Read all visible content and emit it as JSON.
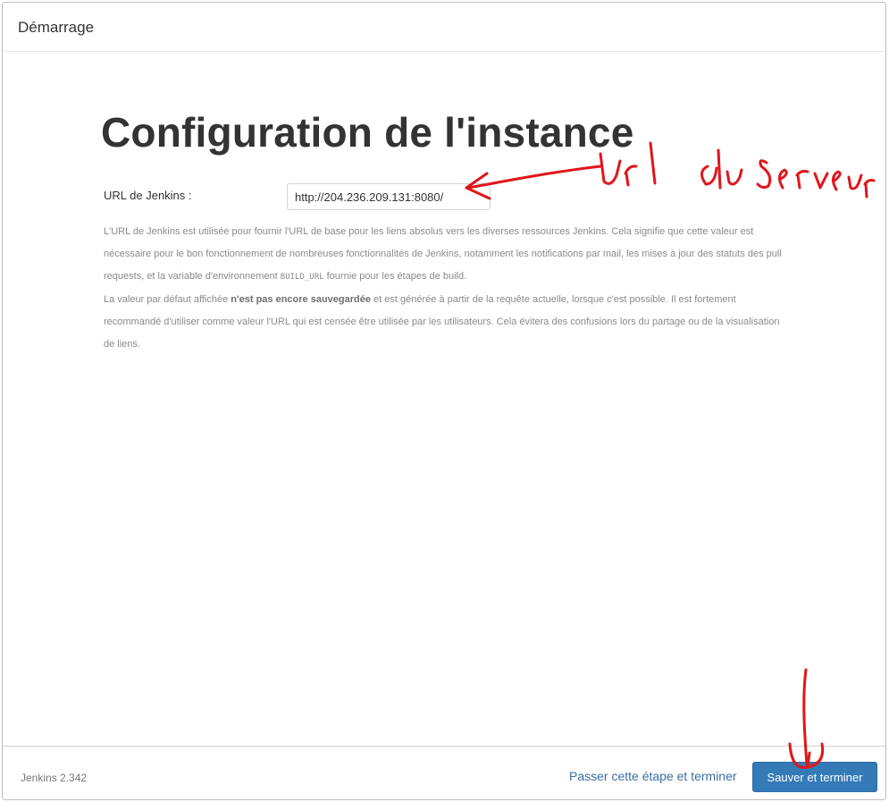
{
  "header": {
    "title": "Démarrage"
  },
  "main": {
    "page_title": "Configuration de l'instance",
    "url_label": "URL de Jenkins :",
    "url_value": "http://204.236.209.131:8080/",
    "help": {
      "p1_a": "L'URL de Jenkins est utilisée pour fournir l'URL de base pour les liens absolus vers les diverses ressources Jenkins. Cela signifie que cette valeur est nécessaire pour le bon fonctionnement de nombreuses fonctionnalités de Jenkins, notamment les notifications par mail, les mises à jour des statuts des pull requests, et la variable d'environnement ",
      "p1_code": "BUILD_URL",
      "p1_b": " fournie pour les étapes de build.",
      "p2_a": "La valeur par défaut affichée ",
      "p2_bold": "n'est pas encore sauvegardée",
      "p2_b": " et est générée à partir de la requête actuelle, lorsque c'est possible. Il est fortement recommandé d'utiliser comme valeur l'URL qui est censée être utilisée par les utilisateurs. Cela évitera des confusions lors du partage ou de la visualisation de liens."
    }
  },
  "footer": {
    "version": "Jenkins 2.342",
    "skip_label": "Passer cette étape et terminer",
    "save_label": "Sauver et terminer"
  },
  "annotations": {
    "handwritten_note": "Url du Serveur",
    "ink_color": "#e0161b"
  },
  "colors": {
    "primary_button": "#337ab7",
    "link": "#3a6ea5",
    "title_text": "#333333",
    "help_text": "#8a8a8a"
  }
}
